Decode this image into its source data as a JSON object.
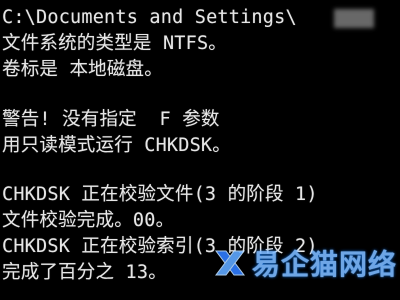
{
  "console": {
    "lines": [
      "C:\\Documents and Settings\\",
      "文件系统的类型是 NTFS。",
      "卷标是 本地磁盘。",
      "警告! 没有指定  F 参数",
      "用只读模式运行 CHKDSK。",
      "CHKDSK 正在校验文件(3 的阶段 1)",
      "文件校验完成。00。",
      "CHKDSK 正在校验索引(3 的阶段 2)",
      "完成了百分之 13。"
    ]
  },
  "watermark": {
    "text": "易企猫网络",
    "color": "#7bb8ff",
    "icon": "x-logo-icon"
  }
}
